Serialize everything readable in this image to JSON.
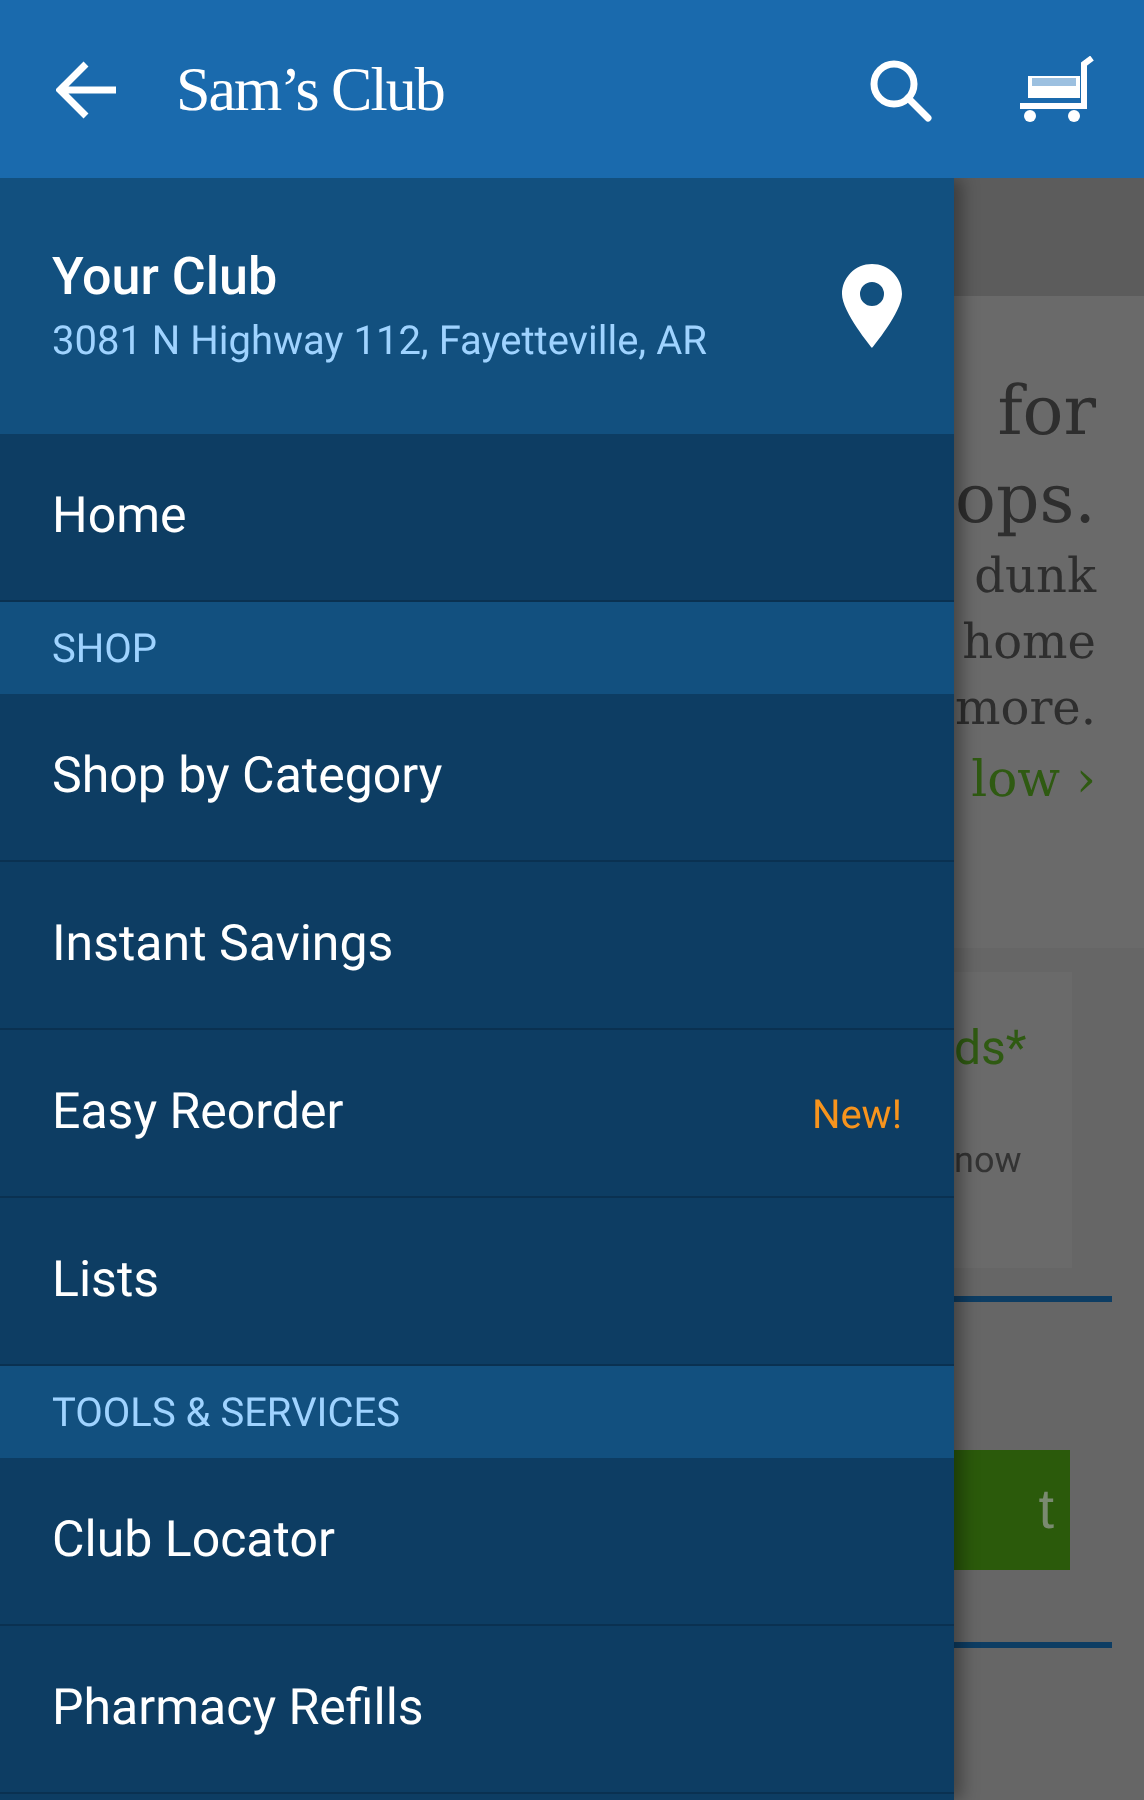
{
  "header": {
    "logo": "Sam’s Club"
  },
  "drawer": {
    "club_title": "Your Club",
    "club_address": "3081 N Highway 112, Fayetteville, AR",
    "items": [
      {
        "kind": "item",
        "label": "Home"
      },
      {
        "kind": "section",
        "label": "SHOP"
      },
      {
        "kind": "item",
        "label": "Shop by Category"
      },
      {
        "kind": "item",
        "label": "Instant Savings"
      },
      {
        "kind": "item",
        "label": "Easy Reorder",
        "badge": "New!"
      },
      {
        "kind": "item",
        "label": "Lists"
      },
      {
        "kind": "section",
        "label": "TOOLS & SERVICES"
      },
      {
        "kind": "item",
        "label": "Club Locator"
      },
      {
        "kind": "item",
        "label": "Pharmacy Refills"
      }
    ]
  },
  "background": {
    "promo_lines": [
      "for",
      "ops.",
      "dunk",
      "home",
      "more."
    ],
    "promo_link": "low ›",
    "card_title": "ds*",
    "card_text": "now",
    "card_button": "t"
  }
}
